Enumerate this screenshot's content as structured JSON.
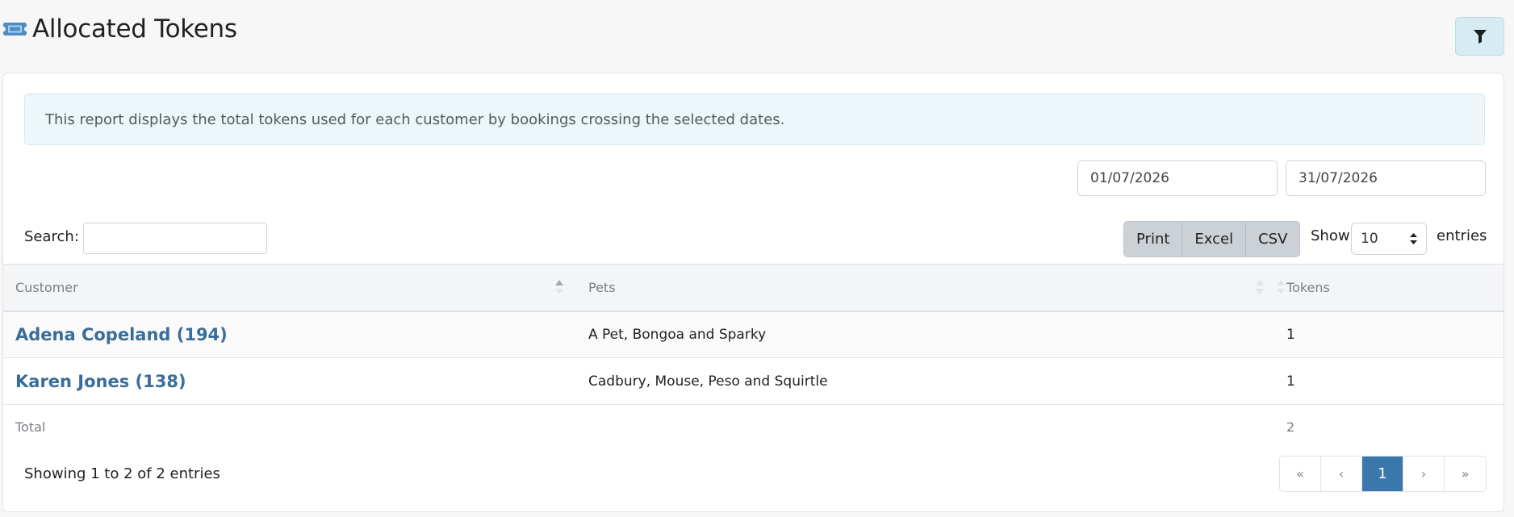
{
  "header": {
    "title": "Allocated Tokens",
    "title_icon": "ticket-icon",
    "filter_icon": "filter-icon"
  },
  "info": {
    "text": "This report displays the total tokens used for each customer by bookings crossing the selected dates."
  },
  "dates": {
    "start": "01/07/2026",
    "end": "31/07/2026"
  },
  "controls": {
    "search_label": "Search:",
    "search_value": "",
    "print_label": "Print",
    "excel_label": "Excel",
    "csv_label": "CSV",
    "show_label": "Show",
    "page_length": "10",
    "entries_label": "entries"
  },
  "table": {
    "columns": [
      "Customer",
      "Pets",
      "Tokens"
    ],
    "rows": [
      {
        "customer": "Adena Copeland (194)",
        "pets": "A Pet, Bongoa and Sparky",
        "tokens": "1"
      },
      {
        "customer": "Karen Jones (138)",
        "pets": "Cadbury, Mouse, Peso and Squirtle",
        "tokens": "1"
      }
    ],
    "footer": {
      "label": "Total",
      "tokens": "2"
    }
  },
  "pagination": {
    "info": "Showing 1 to 2 of 2 entries",
    "first": "«",
    "prev": "‹",
    "current": "1",
    "next": "›",
    "last": "»"
  },
  "colors": {
    "link": "#3a6e9a",
    "active_page": "#3a77ab",
    "info_bg": "#edf6f8",
    "filter_bg": "#d7ecf2"
  }
}
